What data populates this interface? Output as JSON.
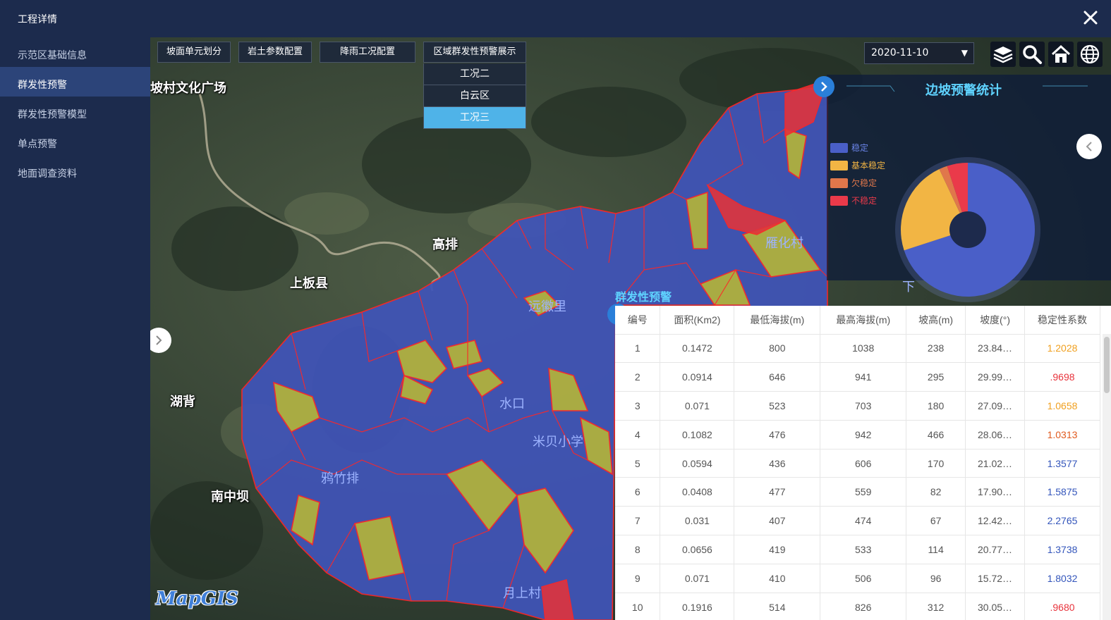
{
  "window": {
    "title": "工程详情"
  },
  "sidebar": {
    "items": [
      {
        "label": "示范区基础信息",
        "active": false
      },
      {
        "label": "群发性预警",
        "active": true
      },
      {
        "label": "群发性预警模型",
        "active": false
      },
      {
        "label": "单点预警",
        "active": false
      },
      {
        "label": "地面调查资料",
        "active": false
      }
    ]
  },
  "toolbar": {
    "buttons": [
      "坡面单元划分",
      "岩土参数配置",
      "降雨工况配置",
      "区域群发性预警展示"
    ],
    "dropdown": [
      {
        "label": "工况二",
        "active": false
      },
      {
        "label": "白云区",
        "active": false
      },
      {
        "label": "工况三",
        "active": true
      }
    ],
    "date": "2020-11-10",
    "icons": [
      "layers-icon",
      "search-icon",
      "home-icon",
      "globe-icon"
    ]
  },
  "map": {
    "places": [
      "坡村文化广场",
      "高排",
      "上板县",
      "湖背",
      "南中坝",
      "远徽里",
      "水口",
      "米贝小学",
      "鸦竹排",
      "月上村",
      "雁化村",
      "下"
    ],
    "colors": {
      "stable": "#4255c0",
      "basic_stable": "#b8b536",
      "owe_stable": "#d4623a",
      "unstable": "#e0343c",
      "boundary": "#ff2a2a"
    },
    "logo": "MapGIS"
  },
  "stats_panel": {
    "title": "边坡预警统计",
    "legend": [
      {
        "label": "稳定",
        "color": "#4a5fc8",
        "text_color": "#6a84e8"
      },
      {
        "label": "基本稳定",
        "color": "#f2b544",
        "text_color": "#f2b544"
      },
      {
        "label": "欠稳定",
        "color": "#e0774b",
        "text_color": "#e0774b"
      },
      {
        "label": "不稳定",
        "color": "#ea3a4a",
        "text_color": "#ea3a4a"
      }
    ],
    "pie_values": [
      70,
      23,
      2,
      5
    ]
  },
  "warning_table": {
    "label": "群发性预警",
    "headers": [
      "编号",
      "面积(Km2)",
      "最低海拔(m)",
      "最高海拔(m)",
      "坡高(m)",
      "坡度(°)",
      "稳定性系数"
    ],
    "rows": [
      {
        "id": "1",
        "area": "0.1472",
        "min_alt": "800",
        "max_alt": "1038",
        "height": "238",
        "slope": "23.84…",
        "coef": "1.2028",
        "level": "orange"
      },
      {
        "id": "2",
        "area": "0.0914",
        "min_alt": "646",
        "max_alt": "941",
        "height": "295",
        "slope": "29.99…",
        "coef": ".9698",
        "level": "red"
      },
      {
        "id": "3",
        "area": "0.071",
        "min_alt": "523",
        "max_alt": "703",
        "height": "180",
        "slope": "27.09…",
        "coef": "1.0658",
        "level": "orange"
      },
      {
        "id": "4",
        "area": "0.1082",
        "min_alt": "476",
        "max_alt": "942",
        "height": "466",
        "slope": "28.06…",
        "coef": "1.0313",
        "level": "darkorange"
      },
      {
        "id": "5",
        "area": "0.0594",
        "min_alt": "436",
        "max_alt": "606",
        "height": "170",
        "slope": "21.02…",
        "coef": "1.3577",
        "level": "blue"
      },
      {
        "id": "6",
        "area": "0.0408",
        "min_alt": "477",
        "max_alt": "559",
        "height": "82",
        "slope": "17.90…",
        "coef": "1.5875",
        "level": "blue"
      },
      {
        "id": "7",
        "area": "0.031",
        "min_alt": "407",
        "max_alt": "474",
        "height": "67",
        "slope": "12.42…",
        "coef": "2.2765",
        "level": "blue"
      },
      {
        "id": "8",
        "area": "0.0656",
        "min_alt": "419",
        "max_alt": "533",
        "height": "114",
        "slope": "20.77…",
        "coef": "1.3738",
        "level": "blue"
      },
      {
        "id": "9",
        "area": "0.071",
        "min_alt": "410",
        "max_alt": "506",
        "height": "96",
        "slope": "15.72…",
        "coef": "1.8032",
        "level": "blue"
      },
      {
        "id": "10",
        "area": "0.1916",
        "min_alt": "514",
        "max_alt": "826",
        "height": "312",
        "slope": "30.05…",
        "coef": ".9680",
        "level": "red"
      }
    ],
    "level_colors": {
      "orange": "#f0a020",
      "red": "#e8333c",
      "darkorange": "#e05a1e",
      "blue": "#3355bb"
    }
  }
}
